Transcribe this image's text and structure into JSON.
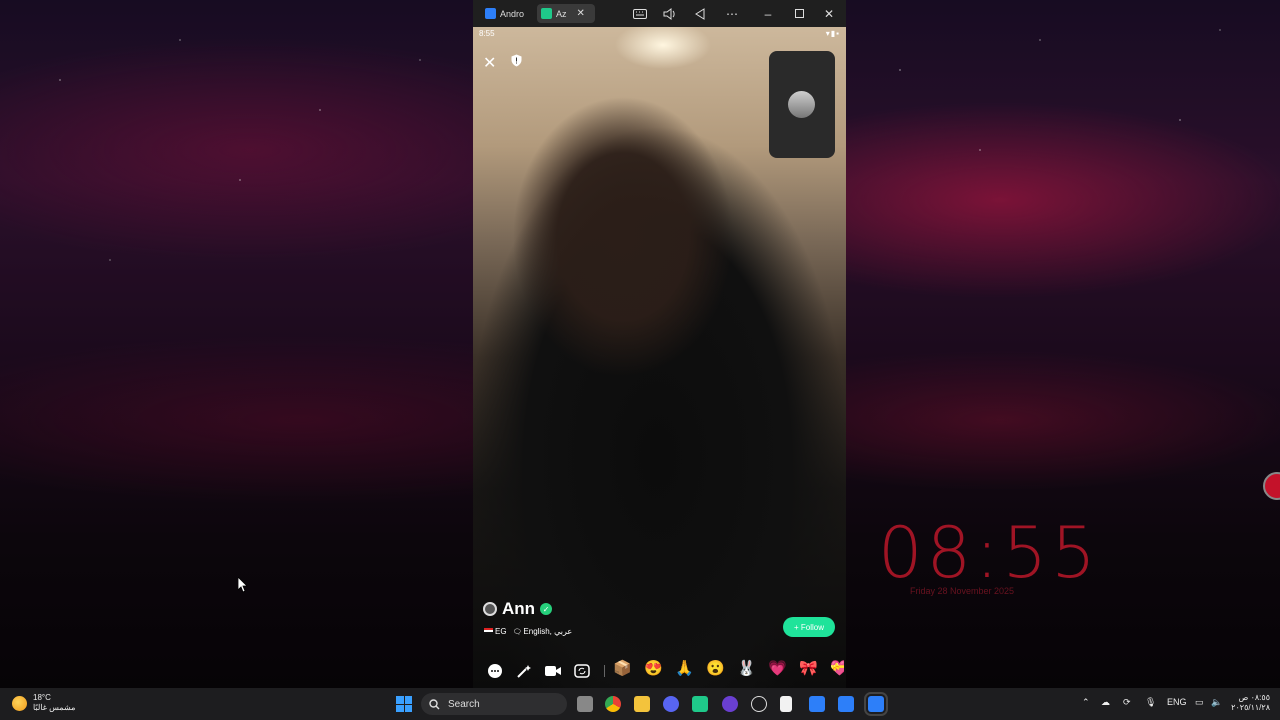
{
  "desktop": {
    "clock_time": "08:55",
    "clock_subtitle": "Friday 28 November 2025"
  },
  "emulator": {
    "tabs": [
      {
        "label": "Andro",
        "icon": "android-emulator-icon"
      },
      {
        "label": "Az",
        "icon": "azar-app-icon"
      }
    ],
    "close_tab_symbol": "✕"
  },
  "phone": {
    "status_time": "8:55",
    "status_icons": "▾▮▪",
    "close_symbol": "✕",
    "user": {
      "name": "Ann",
      "verified_symbol": "✓",
      "country": "EG",
      "languages": "English, عربي"
    },
    "follow_label": "+ Follow",
    "gifts": [
      "📦",
      "😍",
      "🙏",
      "😮",
      "🐰",
      "💗",
      "🎀",
      "💝"
    ]
  },
  "taskbar": {
    "weather_temp": "18°C",
    "weather_desc": "مشمس غالبًا",
    "search_placeholder": "Search",
    "language": "ENG",
    "clock_time": "٠٨:٥٥ ص",
    "clock_date": "٢٠٢٥/١١/٢٨"
  },
  "colors": {
    "accent_follow": "#1fe39a",
    "verified": "#26d07c",
    "desk_clock": "#d2192d"
  }
}
